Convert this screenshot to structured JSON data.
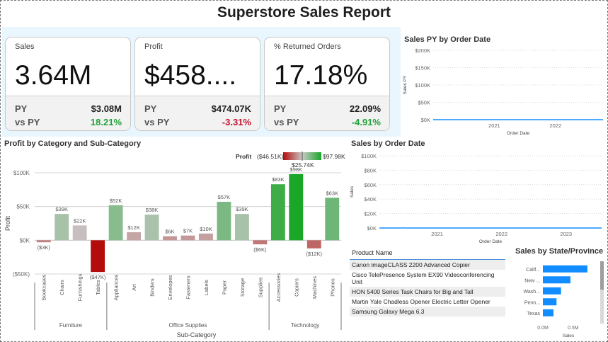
{
  "report_title": "Superstore Sales Report",
  "kpis": [
    {
      "label": "Sales",
      "value": "3.64M",
      "py_label": "PY",
      "py_value": "$3.08M",
      "vs_label": "vs PY",
      "vs_value": "18.21%",
      "vs_sign": "pos"
    },
    {
      "label": "Profit",
      "value": "$458....",
      "py_label": "PY",
      "py_value": "$474.07K",
      "vs_label": "vs PY",
      "vs_value": "-3.31%",
      "vs_sign": "neg"
    },
    {
      "label": "% Returned Orders",
      "value": "17.18%",
      "py_label": "PY",
      "py_value": "22.09%",
      "vs_label": "vs PY",
      "vs_value": "-4.91%",
      "vs_sign": "pos"
    }
  ],
  "profit_chart": {
    "title": "Profit by Category and Sub-Category",
    "legend": {
      "label": "Profit",
      "min": "($46.51K)",
      "mid": "$25.74K",
      "max": "$97.98K",
      "min_color": "#b40b0b",
      "mid_color": "#c8c8c8",
      "max_color": "#1aa627"
    }
  },
  "sales_py_chart": {
    "title": "Sales PY by Order Date"
  },
  "sales_chart": {
    "title": "Sales by Order Date"
  },
  "product_table": {
    "header": "Product Name",
    "rows": [
      "Canon imageCLASS 2200 Advanced Copier",
      "Cisco TelePresence System EX90 Videoconferencing Unit",
      "HON 5400 Series Task Chairs for Big and Tall",
      "Martin Yale Chadless Opener Electric Letter Opener",
      "Samsung Galaxy Mega 6.3"
    ]
  },
  "state_chart": {
    "title": "Sales by State/Province"
  },
  "chart_data": [
    {
      "type": "bar",
      "title": "Profit by Category and Sub-Category",
      "xlabel": "Sub-Category",
      "ylabel": "Profit",
      "ylim": [
        -50000,
        100000
      ],
      "yticks": [
        -50000,
        0,
        50000,
        100000
      ],
      "ytick_labels": [
        "($50K)",
        "$0K",
        "$50K",
        "$100K"
      ],
      "grid": true,
      "categories": [
        "Bookcases",
        "Chairs",
        "Furnishings",
        "Tables",
        "Appliances",
        "Art",
        "Binders",
        "Envelopes",
        "Fasteners",
        "Labels",
        "Paper",
        "Storage",
        "Supplies",
        "Accessories",
        "Copiers",
        "Machines",
        "Phones"
      ],
      "groups": [
        {
          "name": "Furniture",
          "count": 4
        },
        {
          "name": "Office Supplies",
          "count": 9
        },
        {
          "name": "Technology",
          "count": 4
        }
      ],
      "values": [
        -3000,
        39000,
        22000,
        -47000,
        52000,
        12000,
        38000,
        6000,
        7000,
        10000,
        57000,
        39000,
        -6000,
        83000,
        98000,
        -12000,
        63000
      ],
      "data_labels": [
        "($3K)",
        "$39K",
        "$22K",
        "($47K)",
        "$52K",
        "$12K",
        "$38K",
        "$6K",
        "$7K",
        "$10K",
        "$57K",
        "$39K",
        "($6K)",
        "$83K",
        "$98K",
        "($12K)",
        "$63K"
      ]
    },
    {
      "type": "line",
      "title": "Sales PY by Order Date",
      "xlabel": "Order Date",
      "ylabel": "Sales PY",
      "ylim": [
        0,
        200000
      ],
      "yticks": [
        0,
        50000,
        100000,
        150000,
        200000
      ],
      "ytick_labels": [
        "$0K",
        "$50K",
        "$100K",
        "$150K",
        "$200K"
      ],
      "xtick_labels": [
        "2021",
        "2022"
      ],
      "color": "#118dff",
      "values": [
        25,
        3,
        14,
        7,
        20,
        1,
        9,
        12,
        4,
        18,
        2,
        30,
        6,
        11,
        150,
        5,
        16,
        3,
        22,
        8,
        13,
        2,
        35,
        4,
        10,
        19,
        6,
        27,
        3,
        12,
        8,
        40,
        5,
        14,
        2,
        23,
        9,
        30,
        4,
        17,
        11,
        6,
        45,
        3,
        20,
        8,
        13,
        2,
        26,
        7,
        15,
        50,
        4,
        18,
        10,
        3,
        28,
        6,
        21,
        9,
        14,
        2,
        33,
        5,
        60,
        12,
        7,
        24,
        3,
        16,
        10,
        36,
        5,
        19,
        8,
        13,
        4,
        150,
        6,
        22,
        11,
        3,
        28,
        9,
        17,
        5,
        38,
        12,
        7,
        25,
        4,
        16,
        10,
        31,
        6,
        19,
        8,
        44,
        13,
        5
      ]
    },
    {
      "type": "line",
      "title": "Sales by Order Date",
      "xlabel": "Order Date",
      "ylabel": "Sales",
      "ylim": [
        0,
        100000
      ],
      "yticks": [
        0,
        20000,
        40000,
        60000,
        80000,
        100000
      ],
      "ytick_labels": [
        "$0K",
        "$20K",
        "$40K",
        "$60K",
        "$80K",
        "$100K"
      ],
      "xtick_labels": [
        "2021",
        "2022",
        "2023"
      ],
      "color": "#118dff",
      "values": [
        12,
        2,
        8,
        15,
        4,
        22,
        6,
        11,
        3,
        9,
        18,
        5,
        75,
        7,
        14,
        2,
        10,
        20,
        4,
        13,
        6,
        25,
        3,
        9,
        16,
        5,
        12,
        2,
        19,
        8,
        30,
        4,
        11,
        6,
        22,
        3,
        14,
        9,
        28,
        5,
        12,
        2,
        17,
        7,
        35,
        4,
        10,
        6,
        24,
        3,
        15,
        8,
        20,
        5,
        13,
        2,
        27,
        9,
        40,
        6,
        11,
        4,
        18,
        3,
        12,
        7,
        22,
        5,
        30,
        8,
        14,
        2,
        19,
        6,
        25,
        4,
        10,
        9,
        33,
        3,
        16,
        7,
        21,
        5,
        12,
        2,
        28,
        8,
        15,
        4,
        20,
        6,
        38,
        3,
        13,
        9,
        24,
        5,
        11,
        7,
        17,
        4,
        26,
        2,
        14,
        8,
        31,
        6,
        12,
        3,
        19,
        5,
        23,
        7
      ]
    },
    {
      "type": "bar",
      "orientation": "horizontal",
      "title": "Sales by State/Province",
      "xlabel": "Sales",
      "xlim": [
        0,
        900000
      ],
      "xticks": [
        0,
        500000
      ],
      "xtick_labels": [
        "0.0M",
        "0.5M"
      ],
      "categories": [
        "Calif...",
        "New ...",
        "Wash...",
        "Penn...",
        "Texas"
      ],
      "values": [
        735000,
        455000,
        300000,
        225000,
        175000
      ],
      "color": "#118dff"
    }
  ]
}
